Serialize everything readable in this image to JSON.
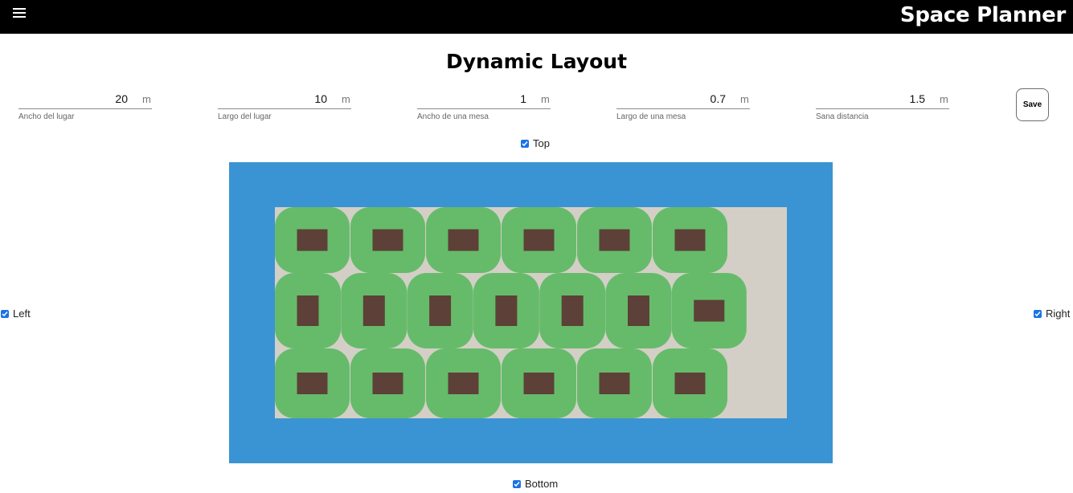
{
  "header": {
    "app_title": "Space Planner",
    "menu_icon": "hamburger-menu-icon"
  },
  "page_title": "Dynamic Layout",
  "fields": [
    {
      "value": "20",
      "unit": "m",
      "label": "Ancho del lugar"
    },
    {
      "value": "10",
      "unit": "m",
      "label": "Largo del lugar"
    },
    {
      "value": "1",
      "unit": "m",
      "label": "Ancho de una mesa"
    },
    {
      "value": "0.7",
      "unit": "m",
      "label": "Largo de una mesa"
    },
    {
      "value": "1.5",
      "unit": "m",
      "label": "Sana distancia"
    }
  ],
  "save_label": "Save",
  "sides": {
    "top": {
      "label": "Top",
      "checked": true
    },
    "left": {
      "label": "Left",
      "checked": true
    },
    "right": {
      "label": "Right",
      "checked": true
    },
    "bottom": {
      "label": "Bottom",
      "checked": true
    }
  },
  "layout": {
    "rows": [
      {
        "tables": 6,
        "orientation": [
          "h",
          "h",
          "h",
          "h",
          "h",
          "h"
        ]
      },
      {
        "tables": 7,
        "orientation": [
          "v",
          "v",
          "v",
          "v",
          "v",
          "v",
          "h"
        ]
      },
      {
        "tables": 6,
        "orientation": [
          "h",
          "h",
          "h",
          "h",
          "h",
          "h"
        ]
      }
    ],
    "colors": {
      "margin_area": "#3a94d3",
      "floor": "#d3cfc6",
      "distance_zone": "#66bb6a",
      "table": "#5d4037",
      "accent": "#1a73e8"
    }
  }
}
